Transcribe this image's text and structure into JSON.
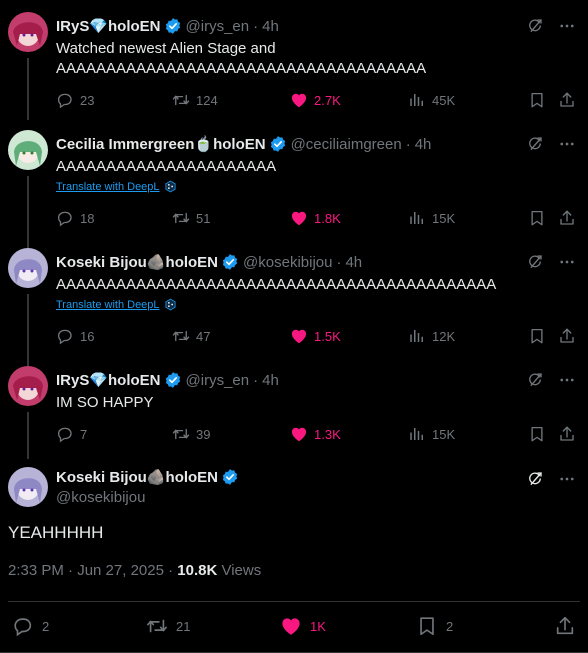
{
  "colors": {
    "background": "#000000",
    "text": "#e7e9ea",
    "muted": "#71767b",
    "like": "#f91880",
    "verified": "#1d9bf0",
    "link": "#1d9bf0",
    "divider": "#2f3336"
  },
  "replies": [
    {
      "name": "IRyS💎holoEN",
      "handle": "@irys_en",
      "time": "4h",
      "lines": [
        "Watched newest Alien Stage and",
        "AAAAAAAAAAAAAAAAAAAAAAAAAAAAAAAAAAAAA"
      ],
      "translate": "",
      "replies": "23",
      "reposts": "124",
      "likes": "2.7K",
      "views": "45K"
    },
    {
      "name": "Cecilia Immergreen🍵holoEN",
      "handle": "@ceciliaimgreen",
      "time": "4h",
      "lines": [
        "AAAAAAAAAAAAAAAAAAAAAA"
      ],
      "translate": "Translate with DeepL",
      "replies": "18",
      "reposts": "51",
      "likes": "1.8K",
      "views": "15K"
    },
    {
      "name": "Koseki Bijou🪨holoEN",
      "handle": "@kosekibijou",
      "time": "4h",
      "lines": [
        "AAAAAAAAAAAAAAAAAAAAAAAAAAAAAAAAAAAAAAAAAAAA"
      ],
      "translate": "Translate with DeepL",
      "replies": "16",
      "reposts": "47",
      "likes": "1.5K",
      "views": "12K"
    },
    {
      "name": "IRyS💎holoEN",
      "handle": "@irys_en",
      "time": "4h",
      "lines": [
        "IM SO HAPPY"
      ],
      "translate": "",
      "replies": "7",
      "reposts": "39",
      "likes": "1.3K",
      "views": "15K"
    }
  ],
  "main": {
    "name": "Koseki Bijou🪨holoEN",
    "handle": "@kosekibijou",
    "text": "YEAHHHHH",
    "timestamp": "2:33 PM · Jun 27, 2025 · ",
    "views_count": "10.8K",
    "views_label": " Views",
    "replies": "2",
    "reposts": "21",
    "likes": "1K",
    "bookmarks": "2"
  },
  "icons": [
    "grok-icon",
    "more-icon",
    "reply-icon",
    "repost-icon",
    "like-icon",
    "views-icon",
    "bookmark-icon",
    "share-icon",
    "verified-icon",
    "deepl-icon"
  ]
}
